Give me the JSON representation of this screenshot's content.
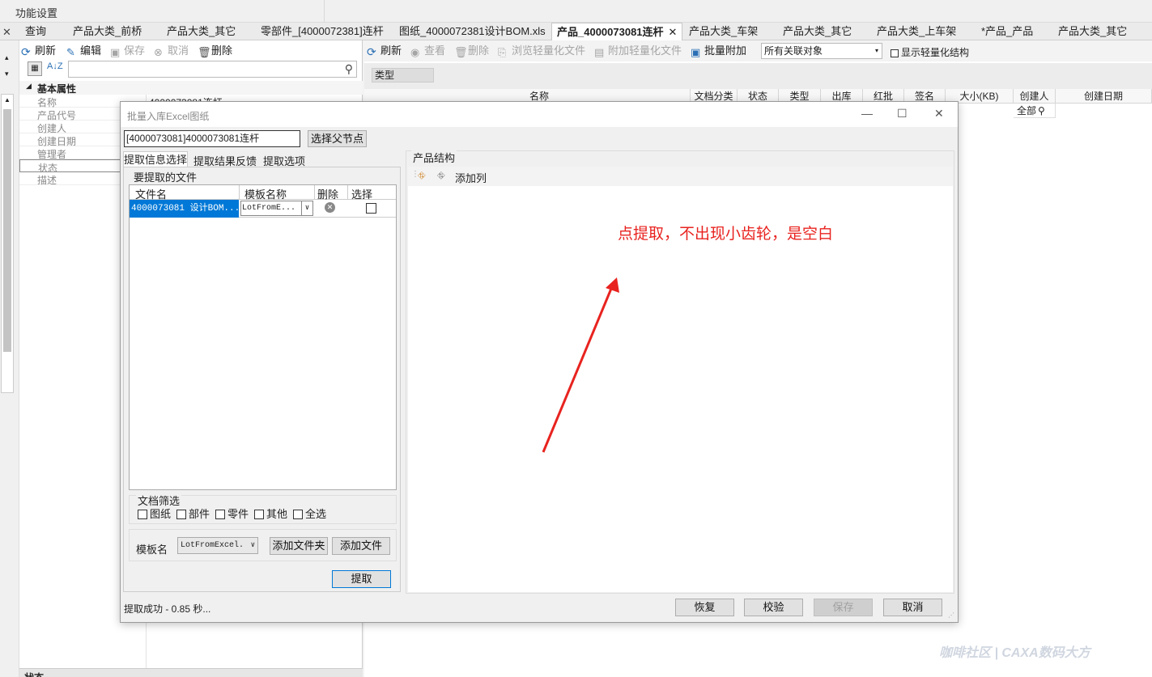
{
  "app": {
    "menu_title": "功能设置"
  },
  "tabs": [
    "查询",
    "产品大类_前桥",
    "产品大类_其它",
    "零部件_[4000072381]连杆",
    "图纸_4000072381设计BOM.xls",
    "产品_4000073081连杆",
    "产品大类_车架",
    "产品大类_其它",
    "产品大类_上车架",
    "*产品_产品",
    "产品大类_其它"
  ],
  "left_toolbar": {
    "refresh": "刷新",
    "edit": "编辑",
    "save": "保存",
    "cancel": "取消",
    "delete": "删除"
  },
  "properties": {
    "group": "基本属性",
    "rows": [
      {
        "key": "名称",
        "value": "4000073081连杆"
      },
      {
        "key": "产品代号",
        "value": ""
      },
      {
        "key": "创建人",
        "value": ""
      },
      {
        "key": "创建日期",
        "value": ""
      },
      {
        "key": "管理者",
        "value": ""
      },
      {
        "key": "状态",
        "value": ""
      },
      {
        "key": "描述",
        "value": ""
      }
    ],
    "bottom_label": "状态"
  },
  "right_toolbar": {
    "refresh": "刷新",
    "view": "查看",
    "delete": "删除",
    "browse_light": "浏览轻量化文件",
    "attach_light": "附加轻量化文件",
    "batch_attach": "批量附加",
    "filter_select": "所有关联对象",
    "show_light_structure": "显示轻量化结构"
  },
  "group_header": "类型",
  "columns": [
    "名称",
    "文档分类",
    "状态",
    "类型",
    "出库",
    "红批",
    "签名",
    "大小(KB)",
    "创建人",
    "创建日期"
  ],
  "filter_all": "全部",
  "dialog": {
    "title": "批量入库Excel图纸",
    "parent_node": "[4000073081]4000073081连杆",
    "select_parent_btn": "选择父节点",
    "tabs": [
      "提取信息选择",
      "提取结果反馈",
      "提取选项"
    ],
    "files_group": "要提取的文件",
    "file_columns": [
      "文件名",
      "模板名称",
      "删除",
      "选择"
    ],
    "file_row": {
      "name": "4000073081 设计BOM...",
      "template": "LotFromE..."
    },
    "filter_group": "文档筛选",
    "filter_options": [
      "图纸",
      "部件",
      "零件",
      "其他",
      "全选"
    ],
    "template_label": "模板名",
    "template_value": "LotFromExcel.",
    "add_folder_btn": "添加文件夹",
    "add_file_btn": "添加文件",
    "extract_btn": "提取",
    "structure_group": "产品结构",
    "add_column": "添加列",
    "annotation": "点提取，不出现小齿轮，是空白",
    "status": "提取成功 - 0.85 秒...",
    "restore_btn": "恢复",
    "verify_btn": "校验",
    "save_btn": "保存",
    "cancel_btn": "取消"
  },
  "watermark": "咖啡社区 | CAXA数码大方",
  "colors": {
    "annotation": "#e8231f",
    "selection": "#0078d7"
  }
}
